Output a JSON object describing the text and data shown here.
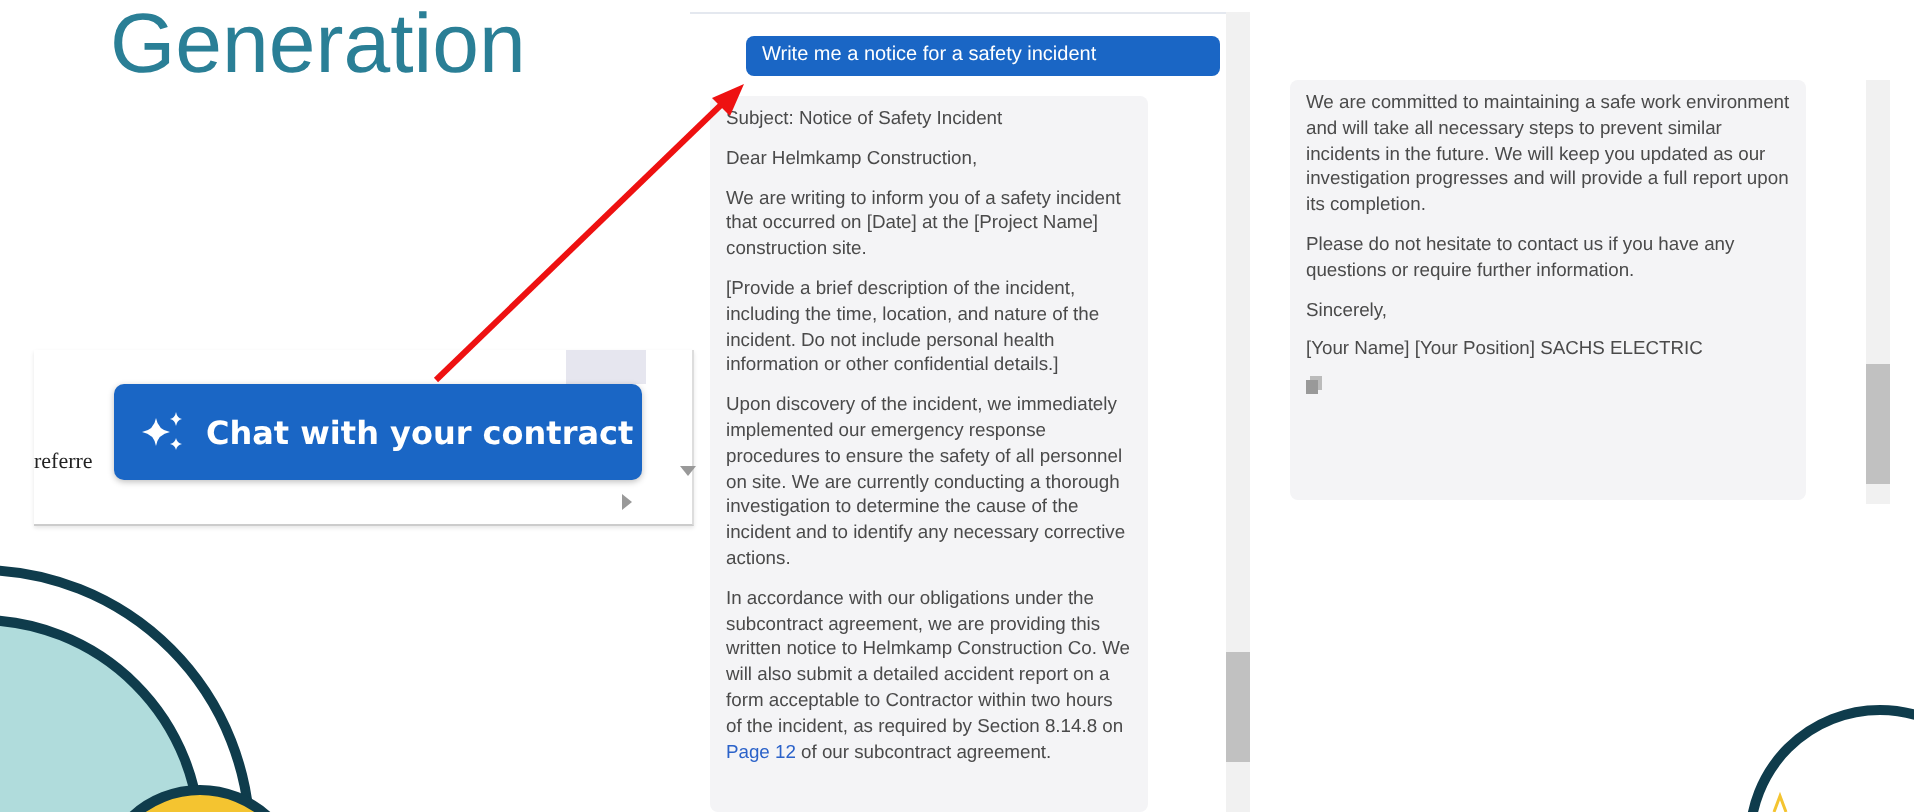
{
  "slide": {
    "title": "Generation"
  },
  "contract_preview": {
    "text_fragment": "referre",
    "button": "Chat with your contract"
  },
  "chat": {
    "user_message": "Write me a notice for a safety incident",
    "reply_paragraphs": [
      {
        "parts": [
          {
            "kind": "text",
            "text": "Subject: Notice of Safety Incident"
          }
        ]
      },
      {
        "parts": [
          {
            "kind": "text",
            "text": "Dear Helmkamp Construction,"
          }
        ]
      },
      {
        "parts": [
          {
            "kind": "text",
            "text": "We are writing to inform you of a safety incident that occurred on [Date] at the [Project Name] construction site."
          }
        ]
      },
      {
        "parts": [
          {
            "kind": "text",
            "text": "[Provide a brief description of the incident, including the time, location, and nature of the incident. Do not include personal health information or other confidential details.]"
          }
        ]
      },
      {
        "parts": [
          {
            "kind": "text",
            "text": "Upon discovery of the incident, we immediately implemented our emergency response procedures to ensure the safety of all personnel on site. We are currently conducting a thorough investigation to determine the cause of the incident and to identify any necessary corrective actions."
          }
        ]
      },
      {
        "parts": [
          {
            "kind": "text",
            "text": "In accordance with our obligations under the subcontract agreement, we are providing this written notice to Helmkamp Construction Co. We will also submit a detailed accident report on a form acceptable to Contractor within two hours of the incident, as required by Section 8.14.8 on "
          },
          {
            "kind": "link",
            "text": "Page 12"
          },
          {
            "kind": "text",
            "text": " of our subcontract agreement."
          }
        ]
      }
    ]
  },
  "chat_continued": {
    "reply_paragraphs": [
      {
        "parts": [
          {
            "kind": "text",
            "text": "We are committed to maintaining a safe work environment and will take all necessary steps to prevent similar incidents in the future. We will keep you updated as our investigation progresses and will provide a full report upon its completion."
          }
        ]
      },
      {
        "parts": [
          {
            "kind": "text",
            "text": "Please do not hesitate to contact us if you have any questions or require further information."
          }
        ]
      },
      {
        "parts": [
          {
            "kind": "text",
            "text": "Sincerely,"
          }
        ]
      },
      {
        "parts": [
          {
            "kind": "text",
            "text": "[Your Name] [Your Position] SACHS ELECTRIC"
          }
        ]
      }
    ]
  }
}
